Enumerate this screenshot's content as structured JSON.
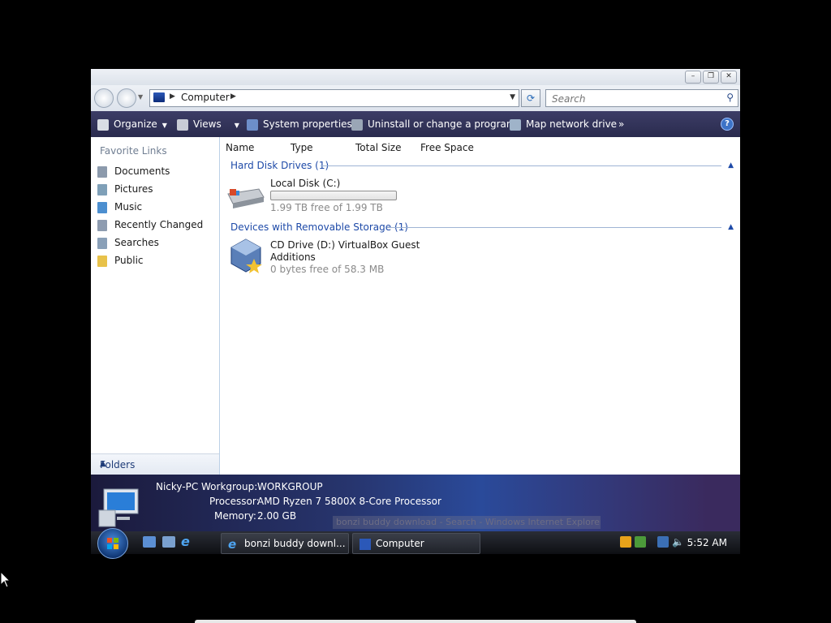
{
  "window": {
    "address": {
      "location": "Computer"
    },
    "search": {
      "placeholder": "Search"
    },
    "toolbar": {
      "organize": "Organize",
      "views": "Views",
      "system_properties": "System properties",
      "uninstall": "Uninstall or change a program",
      "map_network": "Map network drive",
      "more": "»",
      "help": "?"
    },
    "nav": {
      "header": "Favorite Links",
      "items": [
        {
          "label": "Documents",
          "icon": "documents-icon"
        },
        {
          "label": "Pictures",
          "icon": "pictures-icon"
        },
        {
          "label": "Music",
          "icon": "music-icon"
        },
        {
          "label": "Recently Changed",
          "icon": "recently-changed-icon"
        },
        {
          "label": "Searches",
          "icon": "searches-icon"
        },
        {
          "label": "Public",
          "icon": "public-folder-icon"
        }
      ],
      "folders": "Folders"
    },
    "columns": {
      "name": "Name",
      "type": "Type",
      "total_size": "Total Size",
      "free_space": "Free Space"
    },
    "groups": {
      "hdd": {
        "title": "Hard Disk Drives (1)",
        "item": {
          "name": "Local Disk (C:)",
          "free": "1.99 TB free of 1.99 TB",
          "used_fraction": 0.0
        }
      },
      "removable": {
        "title": "Devices with Removable Storage (1)",
        "item": {
          "name_line1": "CD Drive (D:) VirtualBox Guest",
          "name_line2": "Additions",
          "free": "0 bytes free of 58.3 MB"
        }
      }
    }
  },
  "details": {
    "computer_name": "Nicky-PC",
    "workgroup_label": "Workgroup:",
    "workgroup": "WORKGROUP",
    "processor_label": "Processor:",
    "processor": "AMD Ryzen 7 5800X 8-Core Processor",
    "memory_label": "Memory:",
    "memory": "2.00 GB"
  },
  "taskbar": {
    "tasks": [
      {
        "label": "bonzi buddy downl..."
      },
      {
        "label": "Computer"
      }
    ],
    "clock": "5:52 AM",
    "tooltip": "bonzi buddy download - Search - Windows Internet Explorer"
  }
}
